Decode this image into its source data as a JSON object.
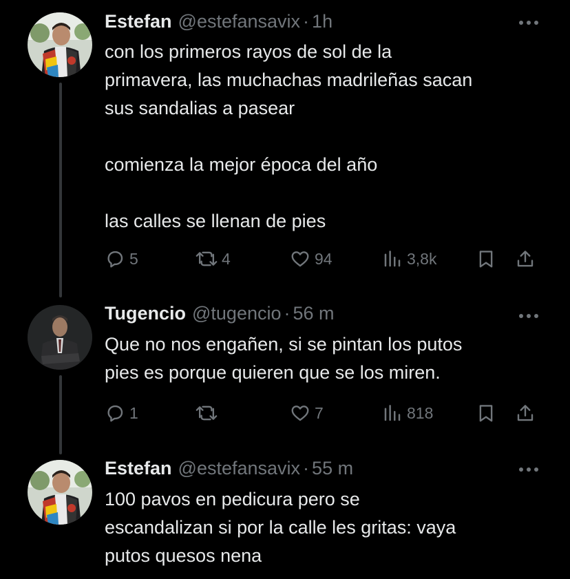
{
  "tweets": [
    {
      "name": "Estefan",
      "handle": "@estefansavix",
      "time": "1h",
      "text": "con los primeros rayos de sol de la\nprimavera, las muchachas madrileñas sacan\nsus sandalias a pasear\n\ncomienza la mejor época del año\n\nlas calles se llenan de pies",
      "replies": "5",
      "retweets": "4",
      "likes": "94",
      "views": "3,8k"
    },
    {
      "name": "Tugencio",
      "handle": "@tugencio",
      "time": "56 m",
      "text": "Que no nos engañen, si se pintan los putos\npies es porque quieren que se los miren.",
      "replies": "1",
      "retweets": "",
      "likes": "7",
      "views": "818"
    },
    {
      "name": "Estefan",
      "handle": "@estefansavix",
      "time": "55 m",
      "text": "100 pavos en pedicura pero se\nescandalizan si por la calle les gritas: vaya\nputos quesos nena"
    }
  ],
  "separator": "·",
  "icons": {
    "more": "more-dots-icon",
    "reply": "reply-icon",
    "retweet": "retweet-icon",
    "like": "heart-icon",
    "views": "views-icon",
    "bookmark": "bookmark-icon",
    "share": "share-icon"
  },
  "colors": {
    "background": "#000000",
    "text": "#e7e9ea",
    "muted": "#71767b",
    "thread_line": "#333639"
  }
}
